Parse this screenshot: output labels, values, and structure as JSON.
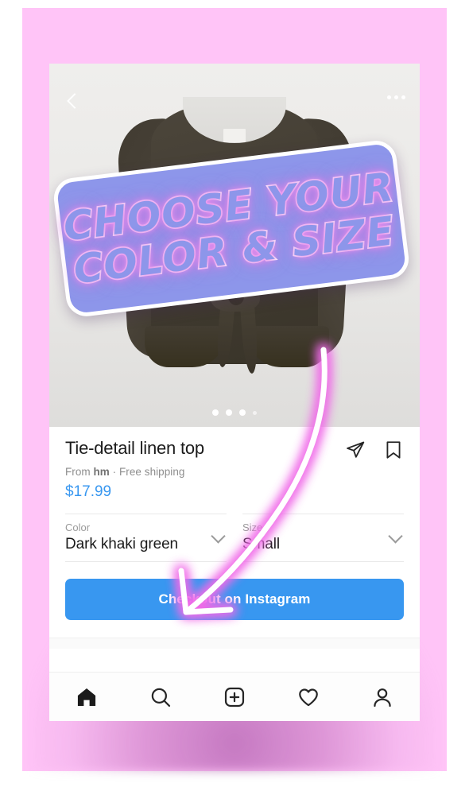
{
  "frame": {
    "matte_color": "#ffc4f7",
    "page_background": "#ffffff"
  },
  "overlay": {
    "banner": {
      "line1": "CHOOSE YOUR",
      "line2": "COLOR & SIZE",
      "background_color": "#8d96ea",
      "text_fill_color": "#ffffff",
      "glow_color": "#ef9bf0"
    },
    "arrow": {
      "name": "curved-arrow-pointing-to-color-selector",
      "stroke_color": "#ffffff",
      "glow_color": "#f06ae8"
    }
  },
  "photo": {
    "back_icon": "chevron-left-icon",
    "more_icon": "more-options-icon",
    "background_color": "#e9e8e6",
    "garment_color": "#443e33",
    "carousel": {
      "dots": [
        {
          "active": true
        },
        {
          "active": true
        },
        {
          "active": true
        },
        {
          "active": false
        }
      ]
    }
  },
  "product": {
    "title": "Tie-detail linen top",
    "merchant_prefix": "From ",
    "merchant_name": "hm",
    "merchant_suffix": " · Free shipping",
    "price": "$17.99",
    "price_color": "#3897f0",
    "actions": [
      {
        "name": "share-icon"
      },
      {
        "name": "bookmark-icon"
      }
    ]
  },
  "variants": [
    {
      "label": "Color",
      "value": "Dark khaki green"
    },
    {
      "label": "Size",
      "value": "Small"
    }
  ],
  "checkout": {
    "label": "Checkout on Instagram",
    "color": "#3897f0"
  },
  "tabbar": {
    "items": [
      {
        "icon": "home-icon",
        "active": true
      },
      {
        "icon": "search-icon",
        "active": false
      },
      {
        "icon": "add-post-icon",
        "active": false
      },
      {
        "icon": "heart-icon",
        "active": false
      },
      {
        "icon": "profile-icon",
        "active": false
      }
    ]
  }
}
